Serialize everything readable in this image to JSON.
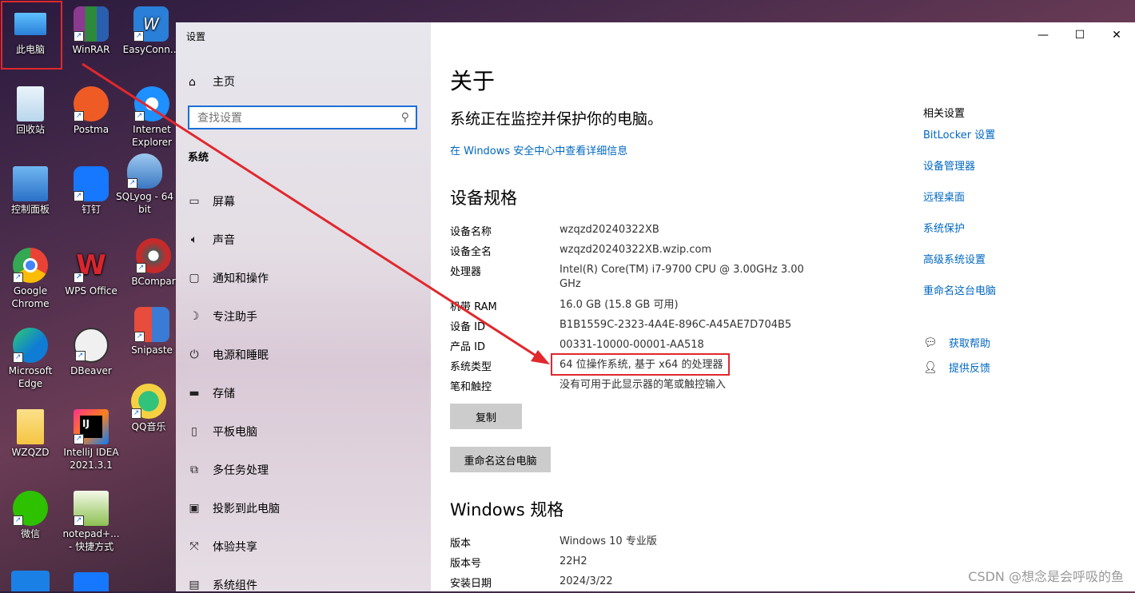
{
  "desktop": {
    "icons": [
      {
        "label": "此电脑",
        "icon": "this-pc-icon",
        "color": "#3aa0e8"
      },
      {
        "label": "WinRAR",
        "icon": "winrar-icon",
        "color": "#8b3a8f"
      },
      {
        "label": "EasyConn...",
        "icon": "easyconnect-icon",
        "color": "#2a7fd8"
      },
      {
        "label": "回收站",
        "icon": "recycle-bin-icon",
        "color": "#cfe3f3"
      },
      {
        "label": "Postma",
        "icon": "postman-icon",
        "color": "#ef5b25"
      },
      {
        "label": "Internet Explorer",
        "icon": "internet-explorer-icon",
        "color": "#1e90ff"
      },
      {
        "label": "控制面板",
        "icon": "control-panel-icon",
        "color": "#3b8ed8"
      },
      {
        "label": "钉钉",
        "icon": "dingtalk-icon",
        "color": "#1677ff"
      },
      {
        "label": "SQLyog - 64 bit",
        "icon": "sqlyog-icon",
        "color": "#3a78c2"
      },
      {
        "label": "Google Chrome",
        "icon": "chrome-icon",
        "color": "#34a853"
      },
      {
        "label": "WPS Office",
        "icon": "wps-icon",
        "color": "#d9262c"
      },
      {
        "label": "BCompar",
        "icon": "bcompare-icon",
        "color": "#c72a2a"
      },
      {
        "label": "Microsoft Edge",
        "icon": "edge-icon",
        "color": "#0f7cd6"
      },
      {
        "label": "DBeaver",
        "icon": "dbeaver-icon",
        "color": "#7b5a3c"
      },
      {
        "label": "Snipaste",
        "icon": "snipaste-icon",
        "color": "#3a7bd5"
      },
      {
        "label": "WZQZD",
        "icon": "folder-icon",
        "color": "#f5c542"
      },
      {
        "label": "IntelliJ IDEA 2021.3.1",
        "icon": "intellij-icon",
        "color": "#e6007a"
      },
      {
        "label": "QQ音乐",
        "icon": "qqmusic-icon",
        "color": "#31c27c"
      },
      {
        "label": "微信",
        "icon": "wechat-icon",
        "color": "#2dc100"
      },
      {
        "label": "notepad+... - 快捷方式",
        "icon": "notepadpp-icon",
        "color": "#8cc152"
      }
    ]
  },
  "window": {
    "title": "设置",
    "controls": {
      "minimize": "—",
      "maximize": "☐",
      "close": "✕"
    }
  },
  "nav": {
    "home": "主页",
    "search_placeholder": "查找设置",
    "section": "系统",
    "items": [
      {
        "label": "屏幕",
        "icon": "display-icon"
      },
      {
        "label": "声音",
        "icon": "sound-icon"
      },
      {
        "label": "通知和操作",
        "icon": "notification-icon"
      },
      {
        "label": "专注助手",
        "icon": "focus-assist-icon"
      },
      {
        "label": "电源和睡眠",
        "icon": "power-icon"
      },
      {
        "label": "存储",
        "icon": "storage-icon"
      },
      {
        "label": "平板电脑",
        "icon": "tablet-icon"
      },
      {
        "label": "多任务处理",
        "icon": "multitasking-icon"
      },
      {
        "label": "投影到此电脑",
        "icon": "project-icon"
      },
      {
        "label": "体验共享",
        "icon": "shared-experience-icon"
      },
      {
        "label": "系统组件",
        "icon": "system-components-icon"
      }
    ]
  },
  "about": {
    "title": "关于",
    "protect": "系统正在监控并保护你的电脑。",
    "security_link": "在 Windows 安全中心中查看详细信息",
    "device_heading": "设备规格",
    "device_specs": [
      {
        "label": "设备名称",
        "value": "wzqzd20240322XB"
      },
      {
        "label": "设备全名",
        "value": "wzqzd20240322XB.wzip.com"
      },
      {
        "label": "处理器",
        "value": "Intel(R) Core(TM) i7-9700 CPU @ 3.00GHz   3.00 GHz"
      },
      {
        "label": "机带 RAM",
        "value": "16.0 GB (15.8 GB 可用)"
      },
      {
        "label": "设备 ID",
        "value": "B1B1559C-2323-4A4E-896C-A45AE7D704B5"
      },
      {
        "label": "产品 ID",
        "value": "00331-10000-00001-AA518"
      },
      {
        "label": "系统类型",
        "value": "64 位操作系统, 基于 x64 的处理器"
      },
      {
        "label": "笔和触控",
        "value": "没有可用于此显示器的笔或触控输入"
      }
    ],
    "copy_button": "复制",
    "rename_button": "重命名这台电脑",
    "windows_heading": "Windows 规格",
    "windows_specs": [
      {
        "label": "版本",
        "value": "Windows 10 专业版"
      },
      {
        "label": "版本号",
        "value": "22H2"
      },
      {
        "label": "安装日期",
        "value": "2024/3/22"
      }
    ]
  },
  "related": {
    "heading": "相关设置",
    "links": [
      "BitLocker 设置",
      "设备管理器",
      "远程桌面",
      "系统保护",
      "高级系统设置",
      "重命名这台电脑"
    ],
    "help": [
      {
        "label": "获取帮助",
        "icon": "help-icon"
      },
      {
        "label": "提供反馈",
        "icon": "feedback-icon"
      }
    ]
  },
  "watermark": "CSDN @想念是会呼吸的鱼",
  "colors": {
    "accent": "#0067c0",
    "highlight": "#e0282d"
  }
}
